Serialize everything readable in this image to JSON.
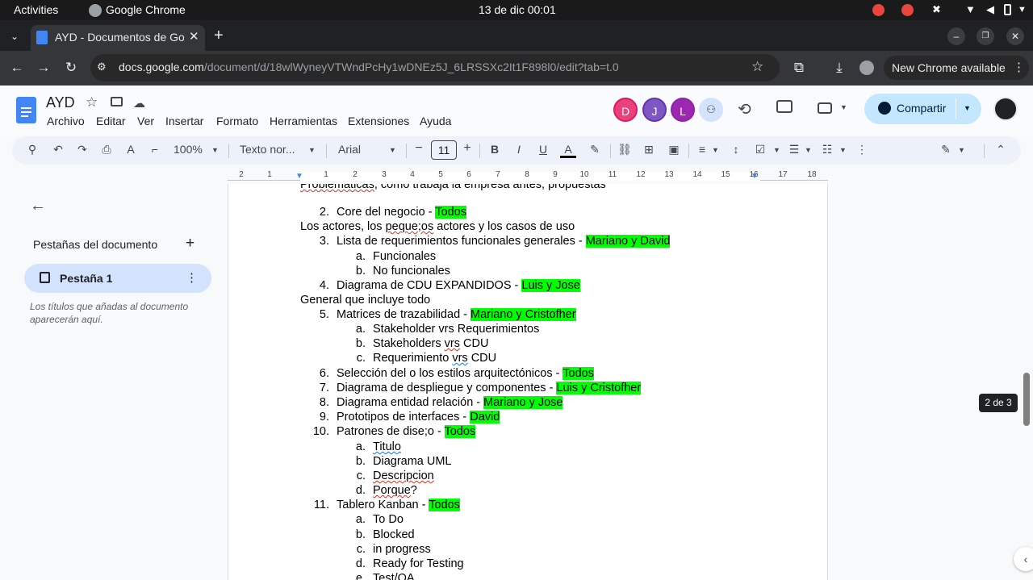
{
  "os_bar": {
    "activities": "Activities",
    "app": "Google Chrome",
    "clock": "13 de dic  00:01"
  },
  "browser": {
    "tab_title": "AYD - Documentos de Go",
    "url_host": "docs.google.com",
    "url_path": "/document/d/18wlWyneyVTWndPcHy1wDNEz5J_6LRSSXc2It1F898l0/edit?tab=t.0",
    "update_label": "New Chrome available"
  },
  "docs": {
    "title": "AYD",
    "menus": [
      "Archivo",
      "Editar",
      "Ver",
      "Insertar",
      "Formato",
      "Herramientas",
      "Extensiones",
      "Ayuda"
    ],
    "share_label": "Compartir",
    "collaborators": [
      {
        "initial": "D",
        "color": "#d81b60"
      },
      {
        "initial": "J",
        "color": "#5e35b1"
      },
      {
        "initial": "L",
        "color": "#8e24aa"
      }
    ]
  },
  "toolbar": {
    "zoom": "100%",
    "style": "Texto nor...",
    "font": "Arial",
    "font_size": "11"
  },
  "ruler": {
    "ticks": [
      "2",
      "1",
      "1",
      "2",
      "3",
      "4",
      "5",
      "6",
      "7",
      "8",
      "9",
      "10",
      "11",
      "12",
      "13",
      "14",
      "15",
      "16",
      "17",
      "18"
    ]
  },
  "sidebar": {
    "heading": "Pestañas del documento",
    "tab_name": "Pestaña 1",
    "hint": "Los títulos que añadas al documento aparecerán aquí."
  },
  "page_indicator": "2 de 3",
  "document": {
    "lines": [
      {
        "text_a": "Problemáticas",
        "text_b": ", como trabaja la empresa antes, propuestas"
      },
      {
        "num": "2.",
        "text": "Core del negocio - ",
        "hl": "Todos"
      },
      {
        "text_a": "Los actores, los ",
        "text_sq": "peque;os",
        "text_b": " actores y los casos de uso"
      },
      {
        "num": "3.",
        "text": "Lista de requerimientos funcionales generales - ",
        "hl": "Mariano y David"
      },
      {
        "num": "a.",
        "text": "Funcionales"
      },
      {
        "num": "b.",
        "text": "No funcionales"
      },
      {
        "num": "4.",
        "text": "Diagrama de CDU EXPANDIDOS - ",
        "hl": " Luis y Jose"
      },
      {
        "text": "General que incluye todo"
      },
      {
        "num": "5.",
        "text": "Matrices de trazabilidad - ",
        "hl": "Mariano y Cristofher"
      },
      {
        "num": "a.",
        "text": "Stakeholder vrs Requerimientos"
      },
      {
        "num": "b.",
        "text_a": "Stakeholders ",
        "text_sq": "vrs",
        "text_b": " CDU"
      },
      {
        "num": "c.",
        "text_a": "Requerimiento ",
        "text_sqb": "vrs",
        "text_b": " CDU"
      },
      {
        "num": "6.",
        "text": "Selección del o los estilos arquitectónicos - ",
        "hl": "Todos"
      },
      {
        "num": "7.",
        "text": "Diagrama de despliegue y componentes -  ",
        "hl": "Luis y Cristofher"
      },
      {
        "num": "8.",
        "text": "Diagrama entidad relación - ",
        "hl": "Mariano y Jose"
      },
      {
        "num": "9.",
        "text": "Prototipos de interfaces - ",
        "hl": "David"
      },
      {
        "num": "10.",
        "text": "Patrones de dise;o - ",
        "hl": "Todos"
      },
      {
        "num": "a.",
        "text_sqb": "Titulo"
      },
      {
        "num": "b.",
        "text": "Diagrama UML"
      },
      {
        "num": "c.",
        "text_sq": "Descripcion"
      },
      {
        "num": "d.",
        "text_sq": "Porque",
        "text_b": "?"
      },
      {
        "num": "11.",
        "text": "Tablero Kanban - ",
        "hl": "Todos"
      },
      {
        "num": "a.",
        "text": "To Do"
      },
      {
        "num": "b.",
        "text": "Blocked"
      },
      {
        "num": "c.",
        "text": "in progress"
      },
      {
        "num": "d.",
        "text": "Ready for Testing"
      },
      {
        "num": "e.",
        "text": "Test/QA"
      }
    ]
  }
}
